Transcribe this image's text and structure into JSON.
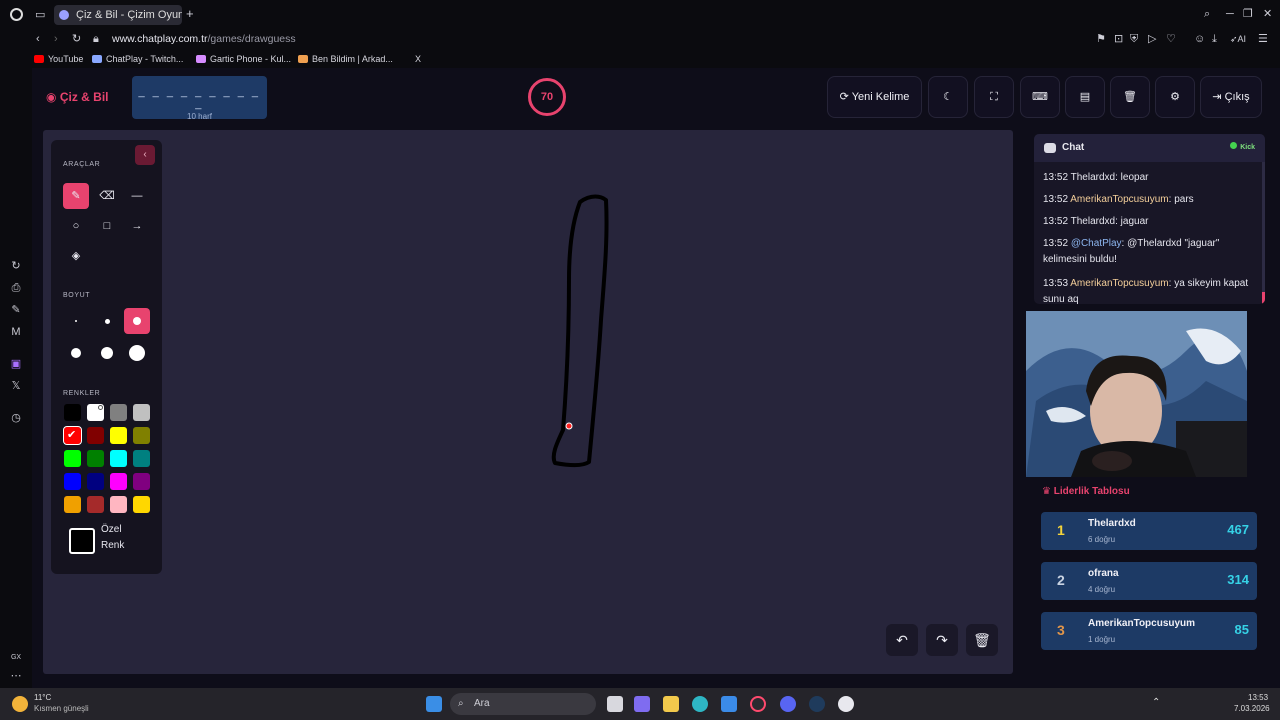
{
  "browser": {
    "tab_title": "Çiz & Bil - Çizim Oyunu",
    "url_domain": "www.chatplay.com.tr",
    "url_path": "/games/drawguess",
    "bookmarks": [
      {
        "label": "YouTube",
        "color": "#ff0000"
      },
      {
        "label": "ChatPlay - Twitch...",
        "color": "#8aa8ff"
      },
      {
        "label": "Gartic Phone - Kul...",
        "color": "#d68cff"
      },
      {
        "label": "Ben Bildim | Arkad...",
        "color": "#f0a050"
      },
      {
        "label": "X",
        "color": "#ffffff"
      }
    ],
    "gx_label": "GX"
  },
  "app": {
    "logo": "Çiz & Bil",
    "word_dashes": "_ _ _ _ _ _ _ _ _ _",
    "word_hint": "10 harf",
    "timer": "70",
    "buttons": {
      "new_word": "Yeni Kelime",
      "exit": "Çıkış"
    }
  },
  "toolbox": {
    "tools_title": "ARAÇLAR",
    "size_title": "BOYUT",
    "colors_title": "RENKLER",
    "custom_color_label": "Özel Renk",
    "colors": [
      "#000000",
      "#ffffff",
      "#808080",
      "#c0c0c0",
      "#ff0000",
      "#800000",
      "#ffff00",
      "#808000",
      "#00ff00",
      "#008000",
      "#00ffff",
      "#008080",
      "#0000ff",
      "#000080",
      "#ff00ff",
      "#800080",
      "#f0a000",
      "#a52a2a",
      "#ffb6c1",
      "#ffd700"
    ],
    "selected_color": "#ff0000"
  },
  "chat": {
    "title": "Chat",
    "platform": "Kick",
    "messages": [
      {
        "time": "13:52",
        "user": "Thelardxd",
        "text": ": leopar"
      },
      {
        "time": "13:52",
        "user": "AmerikanTopcusuyum",
        "text": ": pars"
      },
      {
        "time": "13:52",
        "user": "Thelardxd",
        "text": ": jaguar"
      },
      {
        "time": "13:52",
        "user": "@ChatPlay",
        "text": ": @Thelardxd \"jaguar\" kelimesini buldu!"
      },
      {
        "time": "13:53",
        "user": "AmerikanTopcusuyum",
        "text": ": ya sikeyim kapat sunu aq"
      }
    ]
  },
  "leaderboard": {
    "title": "Liderlik Tablosu",
    "rows": [
      {
        "rank": "1",
        "name": "Thelardxd",
        "correct": "6 doğru",
        "score": "467",
        "rank_color": "#f5d43a"
      },
      {
        "rank": "2",
        "name": "ofrana",
        "correct": "4 doğru",
        "score": "314",
        "rank_color": "#c9d3e2"
      },
      {
        "rank": "3",
        "name": "AmerikanTopcusuyum",
        "correct": "1 doğru",
        "score": "85",
        "rank_color": "#e0954a"
      }
    ]
  },
  "taskbar": {
    "weather_temp": "11°C",
    "weather_desc": "Kısmen güneşli",
    "search_placeholder": "Ara",
    "clock_time": "13:53",
    "clock_date": "7.03.2026"
  }
}
